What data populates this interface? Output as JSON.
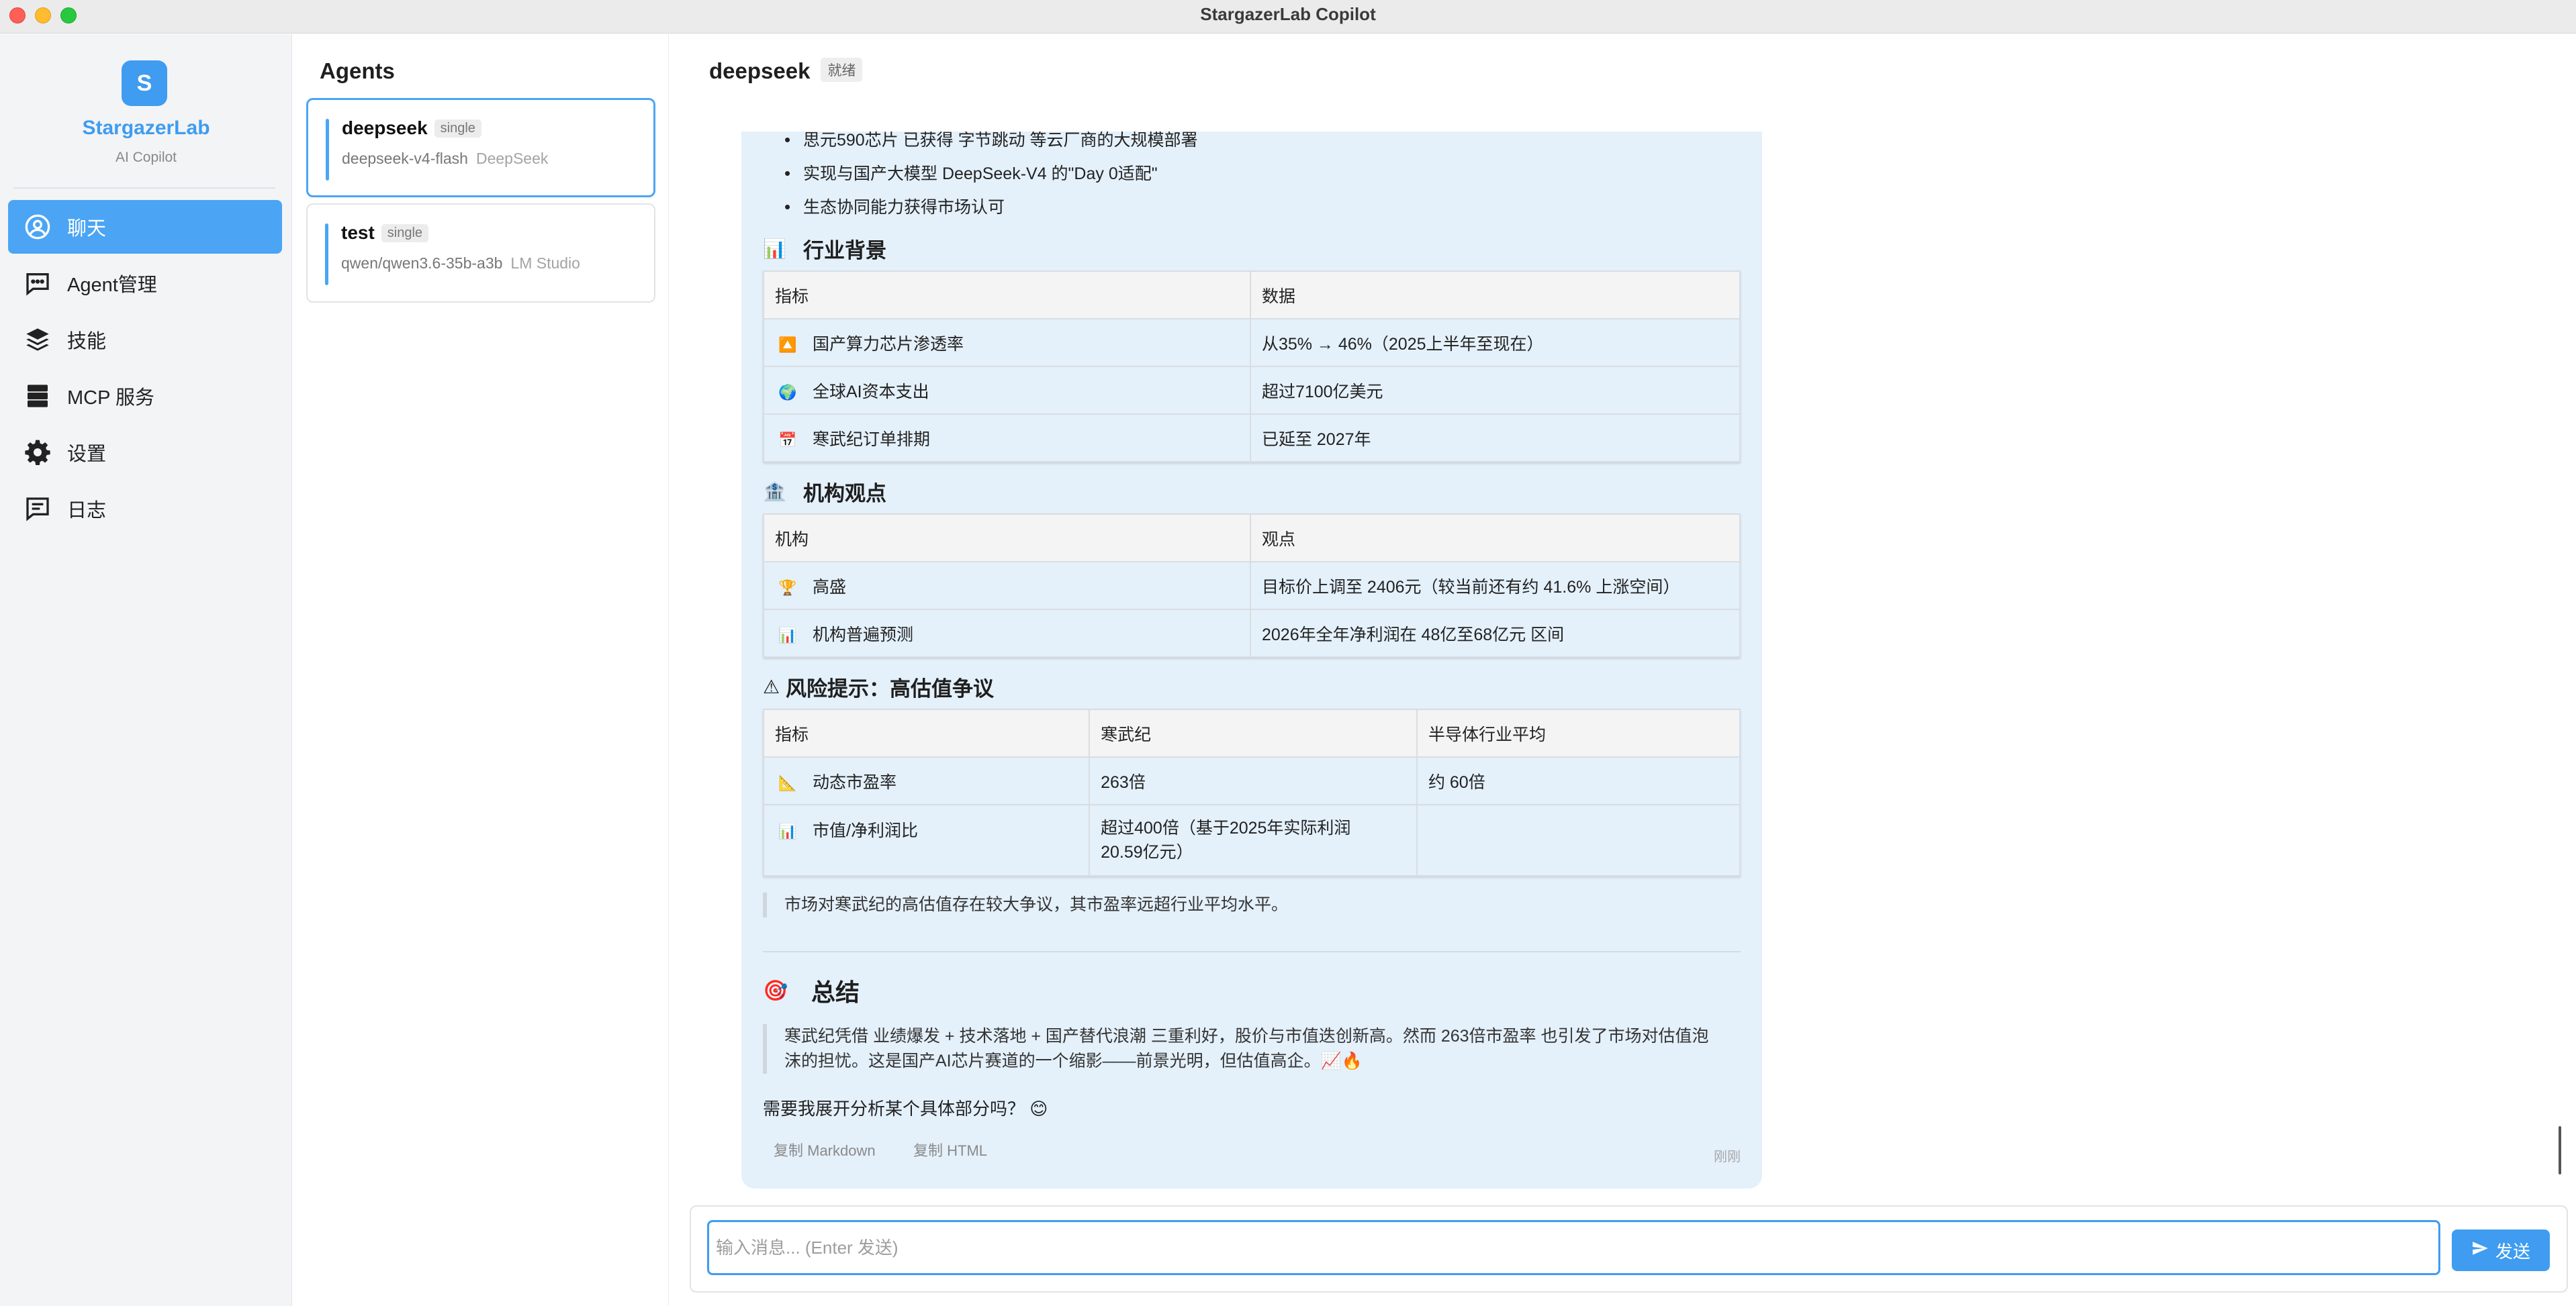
{
  "window": {
    "title": "StargazerLab Copilot"
  },
  "sidebar": {
    "logo_letter": "S",
    "brand": "StargazerLab",
    "brand_sub": "AI Copilot",
    "items": [
      {
        "label": "聊天",
        "icon": "user-circle-icon",
        "active": true
      },
      {
        "label": "Agent管理",
        "icon": "chat-bubble-icon",
        "active": false
      },
      {
        "label": "技能",
        "icon": "layers-icon",
        "active": false
      },
      {
        "label": "MCP 服务",
        "icon": "server-icon",
        "active": false
      },
      {
        "label": "设置",
        "icon": "gear-icon",
        "active": false
      },
      {
        "label": "日志",
        "icon": "log-icon",
        "active": false
      }
    ]
  },
  "agents": {
    "title": "Agents",
    "list": [
      {
        "name": "deepseek",
        "tag": "single",
        "model": "deepseek-v4-flash",
        "provider": "DeepSeek",
        "selected": true
      },
      {
        "name": "test",
        "tag": "single",
        "model": "qwen/qwen3.6-35b-a3b",
        "provider": "LM Studio",
        "selected": false
      }
    ]
  },
  "chat": {
    "agent_name": "deepseek",
    "status": "就绪",
    "message": {
      "bullets": [
        "思元590芯片 已获得 字节跳动 等云厂商的大规模部署",
        "实现与国产大模型 DeepSeek-V4 的\"Day 0适配\"",
        "生态协同能力获得市场认可"
      ],
      "industry": {
        "icon": "📊",
        "title": "行业背景",
        "headers": [
          "指标",
          "数据"
        ],
        "rows": [
          {
            "icon": "🔼",
            "cells": [
              "国产算力芯片渗透率",
              "从35% → 46%（2025上半年至现在）"
            ]
          },
          {
            "icon": "🌍",
            "cells": [
              "全球AI资本支出",
              "超过7100亿美元"
            ]
          },
          {
            "icon": "📅",
            "cells": [
              "寒武纪订单排期",
              "已延至 2027年"
            ]
          }
        ]
      },
      "institutions": {
        "icon": "🏦",
        "title": "机构观点",
        "headers": [
          "机构",
          "观点"
        ],
        "rows": [
          {
            "icon": "🏆",
            "cells": [
              "高盛",
              "目标价上调至 2406元（较当前还有约 41.6% 上涨空间）"
            ]
          },
          {
            "icon": "📊",
            "cells": [
              "机构普遍预测",
              "2026年全年净利润在 48亿至68亿元 区间"
            ]
          }
        ]
      },
      "risk": {
        "icon": "⚠",
        "title": "风险提示：高估值争议",
        "headers": [
          "指标",
          "寒武纪",
          "半导体行业平均"
        ],
        "rows": [
          {
            "icon": "📐",
            "cells": [
              "动态市盈率",
              "263倍",
              "约 60倍"
            ]
          },
          {
            "icon": "📊",
            "cells": [
              "市值/净利润比",
              "超过400倍（基于2025年实际利润20.59亿元）",
              ""
            ]
          }
        ]
      },
      "risk_quote": "市场对寒武纪的高估值存在较大争议，其市盈率远超行业平均水平。",
      "summary": {
        "icon": "🎯",
        "title": "总结",
        "text": "寒武纪凭借 业绩爆发 + 技术落地 + 国产替代浪潮 三重利好，股价与市值迭创新高。然而 263倍市盈率 也引发了市场对估值泡沫的担忧。这是国产AI芯片赛道的一个缩影——前景光明，但估值高企。📈🔥"
      },
      "followup": "需要我展开分析某个具体部分吗？ 😊",
      "copy_markdown": "复制 Markdown",
      "copy_html": "复制 HTML",
      "time": "刚刚"
    },
    "input": {
      "placeholder": "输入消息... (Enter 发送)",
      "value": ""
    },
    "send_label": "发送"
  }
}
